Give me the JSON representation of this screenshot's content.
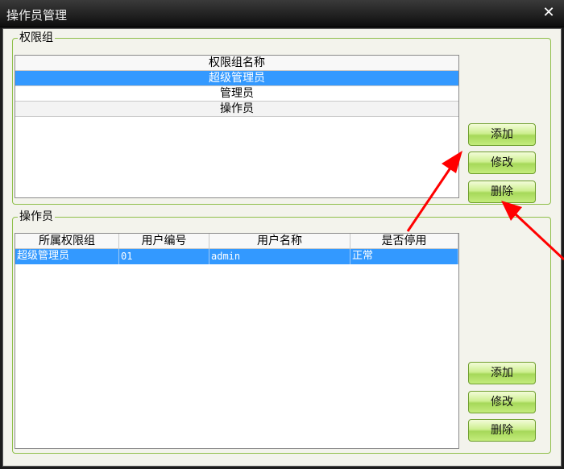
{
  "window": {
    "title": "操作员管理",
    "close_glyph": "✕"
  },
  "groups": {
    "legend": "权限组",
    "header": "权限组名称",
    "rows": [
      "超级管理员",
      "管理员",
      "操作员"
    ],
    "buttons": {
      "add": "添加",
      "edit": "修改",
      "delete": "删除"
    }
  },
  "operators": {
    "legend": "操作员",
    "columns": [
      "所属权限组",
      "用户编号",
      "用户名称",
      "是否停用"
    ],
    "rows": [
      {
        "group": "超级管理员",
        "id": "01",
        "name": "admin",
        "status": "正常"
      }
    ],
    "buttons": {
      "add": "添加",
      "edit": "修改",
      "delete": "删除"
    }
  },
  "colors": {
    "selection": "#3399ff",
    "button_green": "#b5e26b",
    "arrow": "#ff0000",
    "group_border": "#8fbf4a"
  },
  "icons": [
    "close-icon",
    "arrow-annotation-icon"
  ]
}
